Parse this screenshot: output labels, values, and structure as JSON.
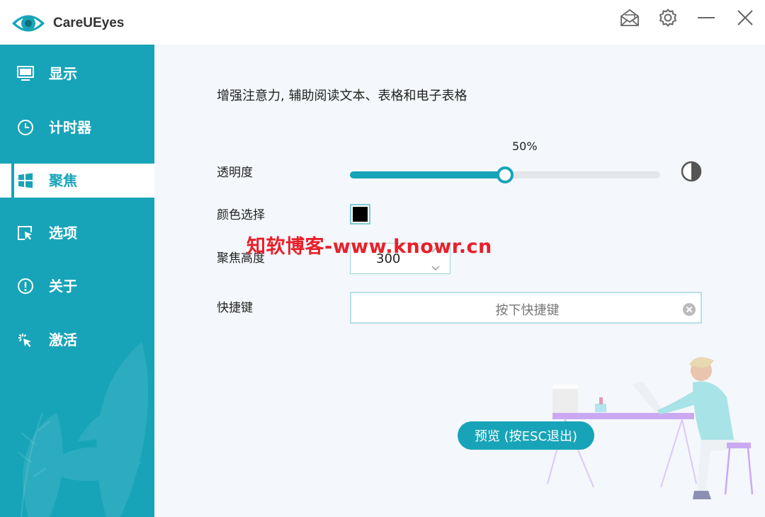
{
  "app": {
    "title": "CareUEyes"
  },
  "titlebar": {
    "buttons": [
      {
        "icon": "mail-icon"
      },
      {
        "icon": "gear-icon"
      },
      {
        "icon": "minimize-icon"
      },
      {
        "icon": "close-icon"
      }
    ]
  },
  "sidebar": {
    "items": [
      {
        "label": "显示",
        "icon": "monitor-icon",
        "active": false
      },
      {
        "label": "计时器",
        "icon": "clock-icon",
        "active": false
      },
      {
        "label": "聚焦",
        "icon": "windows-icon",
        "active": true
      },
      {
        "label": "选项",
        "icon": "cursor-box-icon",
        "active": false
      },
      {
        "label": "关于",
        "icon": "info-circle-icon",
        "active": false
      },
      {
        "label": "激活",
        "icon": "click-sparkle-icon",
        "active": false
      }
    ]
  },
  "focus": {
    "description": "增强注意力, 辅助阅读文本、表格和电子表格",
    "transparency": {
      "label": "透明度",
      "value_text": "50%",
      "value": 0.5
    },
    "color": {
      "label": "颜色选择",
      "value": "#000000"
    },
    "height": {
      "label": "聚焦高度",
      "value": "300"
    },
    "hotkey": {
      "label": "快捷键",
      "placeholder": "按下快捷键"
    },
    "preview_button": "预览 (按ESC退出)"
  },
  "watermark": "知软博客-www.knowr.cn",
  "colors": {
    "accent": "#17a4b8",
    "sidebar": "#17a4b8",
    "main_bg": "#f4f7fb",
    "watermark": "#e8202a"
  }
}
